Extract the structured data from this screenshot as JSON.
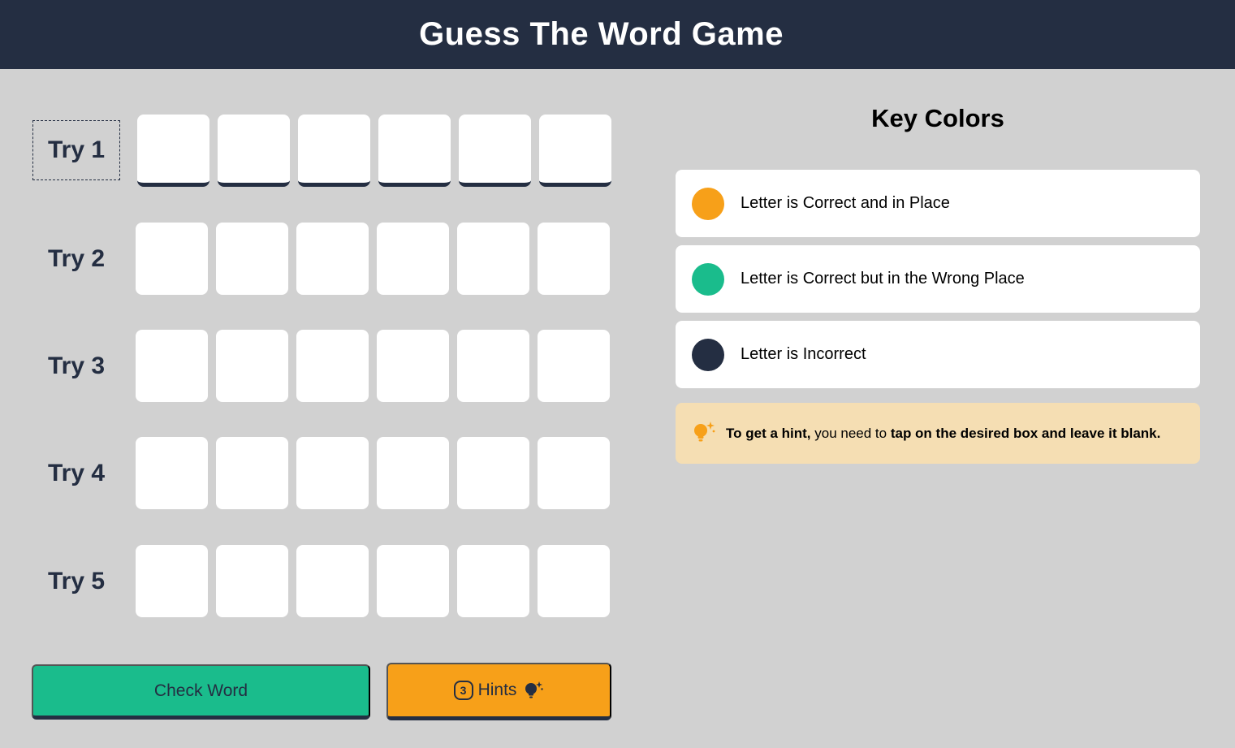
{
  "header": {
    "title": "Guess The Word Game"
  },
  "board": {
    "tries": [
      {
        "label": "Try 1",
        "active": true,
        "letters": [
          "",
          "",
          "",
          "",
          "",
          ""
        ]
      },
      {
        "label": "Try 2",
        "active": false,
        "letters": [
          "",
          "",
          "",
          "",
          "",
          ""
        ]
      },
      {
        "label": "Try 3",
        "active": false,
        "letters": [
          "",
          "",
          "",
          "",
          "",
          ""
        ]
      },
      {
        "label": "Try 4",
        "active": false,
        "letters": [
          "",
          "",
          "",
          "",
          "",
          ""
        ]
      },
      {
        "label": "Try 5",
        "active": false,
        "letters": [
          "",
          "",
          "",
          "",
          "",
          ""
        ]
      }
    ]
  },
  "actions": {
    "check_label": "Check Word",
    "hints_count": "3",
    "hints_label": "Hints"
  },
  "key": {
    "title": "Key Colors",
    "items": [
      {
        "label": "Letter is Correct and in Place",
        "color": "#f7a019",
        "icon": "orange-dot-icon"
      },
      {
        "label": "Letter is Correct but in the Wrong Place",
        "color": "#1abc8c",
        "icon": "green-dot-icon"
      },
      {
        "label": "Letter is Incorrect",
        "color": "#242e42",
        "icon": "navy-dot-icon"
      }
    ]
  },
  "hint_note": {
    "bold_start": "To get a hint,",
    "middle": " you need to ",
    "bold_end": "tap on the desired box and leave it blank."
  },
  "colors": {
    "header_bg": "#242e42",
    "page_bg": "#d1d1d1",
    "check_btn": "#1abc8c",
    "hints_btn": "#f7a019",
    "hint_box_bg": "#f5deb3"
  }
}
